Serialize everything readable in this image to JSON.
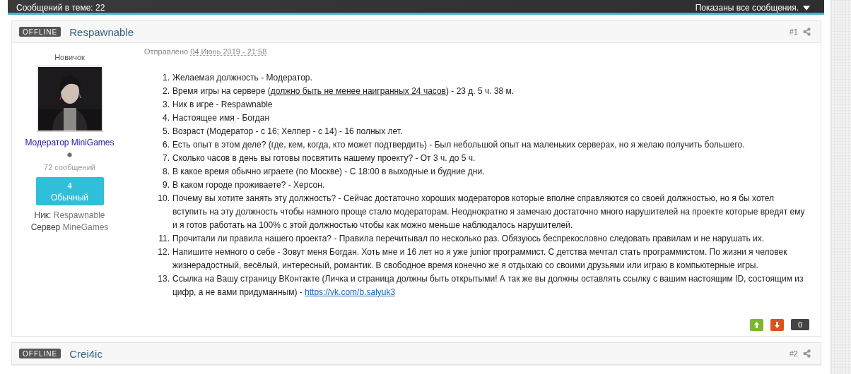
{
  "topbar": {
    "left": "Сообщений в теме: 22",
    "right": "Показаны все сообщения."
  },
  "posts": [
    {
      "status": "OFFLINE",
      "author": "Respawnable",
      "number": "#1",
      "profile": {
        "rank": "Новичок",
        "group": "Модератор MiniGames",
        "posts": "72 сообщений",
        "rep_value": "4",
        "rep_title": "Обычный",
        "fields": [
          {
            "label": "Ник:",
            "value": "Respawnable"
          },
          {
            "label": "Сервер",
            "value": "MineGames"
          }
        ]
      },
      "posted_label": "Отправлено",
      "posted_date": "04 Июнь 2019 - 21:58",
      "items": [
        {
          "marker": "1.",
          "segments": [
            {
              "kind": "plain",
              "text": "Желаемая должность - Модератор."
            }
          ]
        },
        {
          "marker": "2.",
          "segments": [
            {
              "kind": "plain",
              "text": "Время игры на сервере ("
            },
            {
              "kind": "underline",
              "text": "должно быть не менее наигранных 24 часов"
            },
            {
              "kind": "plain",
              "text": ") -  23 д. 5 ч. 38 м."
            }
          ]
        },
        {
          "marker": "3.",
          "segments": [
            {
              "kind": "plain",
              "text": "Ник в игре - Respawnable"
            }
          ]
        },
        {
          "marker": "4.",
          "segments": [
            {
              "kind": "plain",
              "text": "Настоящее имя - Богдан"
            }
          ]
        },
        {
          "marker": "5.",
          "segments": [
            {
              "kind": "plain",
              "text": "Возраст  (Модератор - с 16; Хелпер - с 14) - 16 полных лет."
            }
          ]
        },
        {
          "marker": "6.",
          "segments": [
            {
              "kind": "plain",
              "text": "Есть опыт в этом деле? (где, кем, когда, кто может подтвердить) - Был небольшой опыт на маленьких серверах, но я желаю получить большего."
            }
          ]
        },
        {
          "marker": "7.",
          "segments": [
            {
              "kind": "plain",
              "text": "Сколько часов в день вы готовы посвятить нашему проекту? - От 3 ч. до 5 ч."
            }
          ]
        },
        {
          "marker": "8.",
          "segments": [
            {
              "kind": "plain",
              "text": "В какое время обычно играете (по Москве) - С 18:00 в выходные и будние дни."
            }
          ]
        },
        {
          "marker": "9.",
          "segments": [
            {
              "kind": "plain",
              "text": "В каком городе проживаете? - Херсон."
            }
          ]
        },
        {
          "marker": "10.",
          "segments": [
            {
              "kind": "plain",
              "text": "Почему вы хотите занять эту должность? - Сейчас достаточно хороших модераторов которые вполне справляются со своей должностью, но я бы хотел вступить на эту должность чтобы намного проще стало модераторам. Неоднократно я замечаю достаточно много нарушителей на проекте которые вредят ему и я готов работать на 100% с этой должностью чтобы как можно меньше наблюдалось нарушителей."
            }
          ]
        },
        {
          "marker": "11.",
          "segments": [
            {
              "kind": "plain",
              "text": "Прочитали ли правила нашего проекта? - Правила перечитывал по несколько раз. Обязуюсь беспрекословно следовать правилам и не нарушать их."
            }
          ]
        },
        {
          "marker": "12.",
          "segments": [
            {
              "kind": "plain",
              "text": "Напишите немного о себе - Зовут меня Богдан. Хоть мне и 16 лет но я уже junior программист. С детства мечтал стать программистом. По жизни я человек жизнерадостный, весёлый, интересный, романтик. В свободное время конечно же я отдыхаю со своими друзьями или играю в компьютерные игры."
            }
          ]
        },
        {
          "marker": "13.",
          "segments": [
            {
              "kind": "plain",
              "text": "Ссылка на Вашу страницу ВКонтакте (Личка и страница должны быть открытыми! А так же вы должны оставлять ссылку с вашим настоящим ID, состоящим из цифр, а не вами придуманным) - "
            },
            {
              "kind": "link",
              "text": "https://vk.com/b.salyuk3"
            }
          ]
        }
      ],
      "reputation": "0"
    },
    {
      "status": "OFFLINE",
      "author": "Crei4ic",
      "number": "#2"
    }
  ]
}
